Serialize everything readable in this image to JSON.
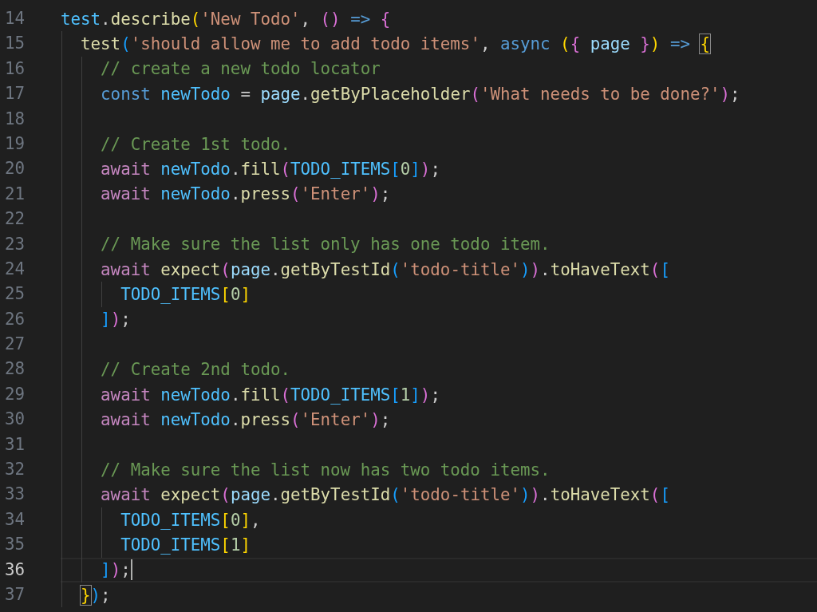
{
  "lines": [
    {
      "number": "14",
      "current": false,
      "tokens": [
        {
          "text": "test",
          "kind": "const"
        },
        {
          "text": ".",
          "kind": "punct"
        },
        {
          "text": "describe",
          "kind": "fn"
        },
        {
          "text": "(",
          "kind": "b1"
        },
        {
          "text": "'New Todo'",
          "kind": "str"
        },
        {
          "text": ", ",
          "kind": "punct"
        },
        {
          "text": "()",
          "kind": "b2"
        },
        {
          "text": " =>",
          "kind": "kw"
        },
        {
          "text": " {",
          "kind": "b2"
        }
      ]
    },
    {
      "number": "15",
      "current": false,
      "tokens": [
        {
          "text": "  test",
          "kind": "fn"
        },
        {
          "text": "(",
          "kind": "b3"
        },
        {
          "text": "'should allow me to add todo items'",
          "kind": "str"
        },
        {
          "text": ", ",
          "kind": "punct"
        },
        {
          "text": "async",
          "kind": "kw"
        },
        {
          "text": " (",
          "kind": "b1"
        },
        {
          "text": "{",
          "kind": "b2"
        },
        {
          "text": " page ",
          "kind": "var"
        },
        {
          "text": "}",
          "kind": "b2"
        },
        {
          "text": ")",
          "kind": "b1"
        },
        {
          "text": " =>",
          "kind": "kw"
        },
        {
          "text": " {",
          "kind": "b1",
          "boxed": true
        }
      ]
    },
    {
      "number": "16",
      "current": false,
      "tokens": [
        {
          "text": "    // create a new todo locator",
          "kind": "comment"
        }
      ]
    },
    {
      "number": "17",
      "current": false,
      "tokens": [
        {
          "text": "    const",
          "kind": "kw"
        },
        {
          "text": " newTodo",
          "kind": "const"
        },
        {
          "text": " = ",
          "kind": "punct"
        },
        {
          "text": "page",
          "kind": "var"
        },
        {
          "text": ".",
          "kind": "punct"
        },
        {
          "text": "getByPlaceholder",
          "kind": "fn"
        },
        {
          "text": "(",
          "kind": "b2"
        },
        {
          "text": "'What needs to be done?'",
          "kind": "str"
        },
        {
          "text": ")",
          "kind": "b2"
        },
        {
          "text": ";",
          "kind": "punct"
        }
      ]
    },
    {
      "number": "18",
      "current": false
    },
    {
      "number": "19",
      "current": false,
      "tokens": [
        {
          "text": "    // Create 1st todo.",
          "kind": "comment"
        }
      ]
    },
    {
      "number": "20",
      "current": false,
      "tokens": [
        {
          "text": "    await",
          "kind": "ctrl"
        },
        {
          "text": " newTodo",
          "kind": "const"
        },
        {
          "text": ".",
          "kind": "punct"
        },
        {
          "text": "fill",
          "kind": "fn"
        },
        {
          "text": "(",
          "kind": "b2"
        },
        {
          "text": "TODO_ITEMS",
          "kind": "const"
        },
        {
          "text": "[",
          "kind": "b3"
        },
        {
          "text": "0",
          "kind": "num"
        },
        {
          "text": "]",
          "kind": "b3"
        },
        {
          "text": ")",
          "kind": "b2"
        },
        {
          "text": ";",
          "kind": "punct"
        }
      ]
    },
    {
      "number": "21",
      "current": false,
      "tokens": [
        {
          "text": "    await",
          "kind": "ctrl"
        },
        {
          "text": " newTodo",
          "kind": "const"
        },
        {
          "text": ".",
          "kind": "punct"
        },
        {
          "text": "press",
          "kind": "fn"
        },
        {
          "text": "(",
          "kind": "b2"
        },
        {
          "text": "'Enter'",
          "kind": "str"
        },
        {
          "text": ")",
          "kind": "b2"
        },
        {
          "text": ";",
          "kind": "punct"
        }
      ]
    },
    {
      "number": "22",
      "current": false
    },
    {
      "number": "23",
      "current": false,
      "tokens": [
        {
          "text": "    // Make sure the list only has one todo item.",
          "kind": "comment"
        }
      ]
    },
    {
      "number": "24",
      "current": false,
      "tokens": [
        {
          "text": "    await",
          "kind": "ctrl"
        },
        {
          "text": " expect",
          "kind": "fn"
        },
        {
          "text": "(",
          "kind": "b2"
        },
        {
          "text": "page",
          "kind": "var"
        },
        {
          "text": ".",
          "kind": "punct"
        },
        {
          "text": "getByTestId",
          "kind": "fn"
        },
        {
          "text": "(",
          "kind": "b3"
        },
        {
          "text": "'todo-title'",
          "kind": "str"
        },
        {
          "text": ")",
          "kind": "b3"
        },
        {
          "text": ")",
          "kind": "b2"
        },
        {
          "text": ".",
          "kind": "punct"
        },
        {
          "text": "toHaveText",
          "kind": "fn"
        },
        {
          "text": "(",
          "kind": "b2"
        },
        {
          "text": "[",
          "kind": "b3"
        }
      ]
    },
    {
      "number": "25",
      "current": false,
      "tokens": [
        {
          "text": "      TODO_ITEMS",
          "kind": "const"
        },
        {
          "text": "[",
          "kind": "b1"
        },
        {
          "text": "0",
          "kind": "num"
        },
        {
          "text": "]",
          "kind": "b1"
        }
      ]
    },
    {
      "number": "26",
      "current": false,
      "tokens": [
        {
          "text": "    ]",
          "kind": "b3"
        },
        {
          "text": ")",
          "kind": "b2"
        },
        {
          "text": ";",
          "kind": "punct"
        }
      ]
    },
    {
      "number": "27",
      "current": false
    },
    {
      "number": "28",
      "current": false,
      "tokens": [
        {
          "text": "    // Create 2nd todo.",
          "kind": "comment"
        }
      ]
    },
    {
      "number": "29",
      "current": false,
      "tokens": [
        {
          "text": "    await",
          "kind": "ctrl"
        },
        {
          "text": " newTodo",
          "kind": "const"
        },
        {
          "text": ".",
          "kind": "punct"
        },
        {
          "text": "fill",
          "kind": "fn"
        },
        {
          "text": "(",
          "kind": "b2"
        },
        {
          "text": "TODO_ITEMS",
          "kind": "const"
        },
        {
          "text": "[",
          "kind": "b3"
        },
        {
          "text": "1",
          "kind": "num"
        },
        {
          "text": "]",
          "kind": "b3"
        },
        {
          "text": ")",
          "kind": "b2"
        },
        {
          "text": ";",
          "kind": "punct"
        }
      ]
    },
    {
      "number": "30",
      "current": false,
      "tokens": [
        {
          "text": "    await",
          "kind": "ctrl"
        },
        {
          "text": " newTodo",
          "kind": "const"
        },
        {
          "text": ".",
          "kind": "punct"
        },
        {
          "text": "press",
          "kind": "fn"
        },
        {
          "text": "(",
          "kind": "b2"
        },
        {
          "text": "'Enter'",
          "kind": "str"
        },
        {
          "text": ")",
          "kind": "b2"
        },
        {
          "text": ";",
          "kind": "punct"
        }
      ]
    },
    {
      "number": "31",
      "current": false
    },
    {
      "number": "32",
      "current": false,
      "tokens": [
        {
          "text": "    // Make sure the list now has two todo items.",
          "kind": "comment"
        }
      ]
    },
    {
      "number": "33",
      "current": false,
      "tokens": [
        {
          "text": "    await",
          "kind": "ctrl"
        },
        {
          "text": " expect",
          "kind": "fn"
        },
        {
          "text": "(",
          "kind": "b2"
        },
        {
          "text": "page",
          "kind": "var"
        },
        {
          "text": ".",
          "kind": "punct"
        },
        {
          "text": "getByTestId",
          "kind": "fn"
        },
        {
          "text": "(",
          "kind": "b3"
        },
        {
          "text": "'todo-title'",
          "kind": "str"
        },
        {
          "text": ")",
          "kind": "b3"
        },
        {
          "text": ")",
          "kind": "b2"
        },
        {
          "text": ".",
          "kind": "punct"
        },
        {
          "text": "toHaveText",
          "kind": "fn"
        },
        {
          "text": "(",
          "kind": "b2"
        },
        {
          "text": "[",
          "kind": "b3"
        }
      ]
    },
    {
      "number": "34",
      "current": false,
      "tokens": [
        {
          "text": "      TODO_ITEMS",
          "kind": "const"
        },
        {
          "text": "[",
          "kind": "b1"
        },
        {
          "text": "0",
          "kind": "num"
        },
        {
          "text": "]",
          "kind": "b1"
        },
        {
          "text": ",",
          "kind": "punct"
        }
      ]
    },
    {
      "number": "35",
      "current": false,
      "tokens": [
        {
          "text": "      TODO_ITEMS",
          "kind": "const"
        },
        {
          "text": "[",
          "kind": "b1"
        },
        {
          "text": "1",
          "kind": "num"
        },
        {
          "text": "]",
          "kind": "b1"
        }
      ]
    },
    {
      "number": "36",
      "current": true,
      "tokens": [
        {
          "text": "    ]",
          "kind": "b3"
        },
        {
          "text": ")",
          "kind": "b2"
        },
        {
          "text": ";",
          "kind": "punct"
        }
      ]
    },
    {
      "number": "37",
      "current": false,
      "tokens": [
        {
          "text": "  }",
          "kind": "b1",
          "boxed": true
        },
        {
          "text": ")",
          "kind": "b3"
        },
        {
          "text": ";",
          "kind": "punct"
        }
      ]
    }
  ]
}
